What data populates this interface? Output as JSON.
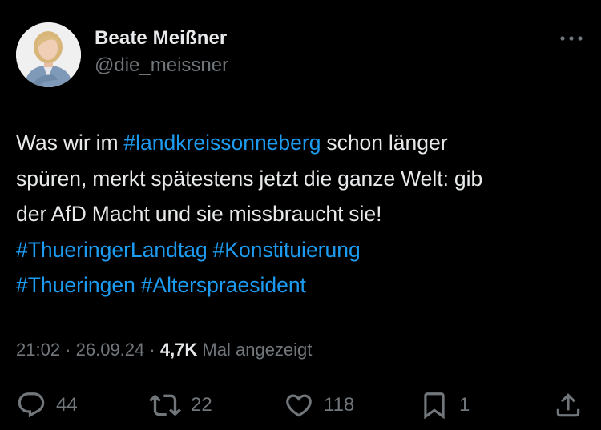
{
  "author": {
    "display_name": "Beate Meißner",
    "handle": "@die_meissner",
    "avatar_icon": "profile-photo"
  },
  "tweet": {
    "lines": [
      [
        {
          "text": "Was wir im ",
          "hashtag": false
        },
        {
          "text": "#landkreissonneberg",
          "hashtag": true
        },
        {
          "text": " schon länger",
          "hashtag": false
        }
      ],
      [
        {
          "text": "spüren, merkt spätestens jetzt die ganze Welt: gib",
          "hashtag": false
        }
      ],
      [
        {
          "text": "der AfD Macht und sie missbraucht sie!",
          "hashtag": false
        }
      ],
      [
        {
          "text": "#ThueringerLandtag",
          "hashtag": true
        },
        {
          "text": " ",
          "hashtag": false
        },
        {
          "text": "#Konstituierung",
          "hashtag": true
        }
      ],
      [
        {
          "text": "#Thueringen",
          "hashtag": true
        },
        {
          "text": " ",
          "hashtag": false
        },
        {
          "text": "#Alterspraesident",
          "hashtag": true
        }
      ]
    ]
  },
  "meta": {
    "time": "21:02",
    "separator": " · ",
    "date": "26.09.24",
    "views_count": "4,7K",
    "views_label": " Mal angezeigt"
  },
  "actions": {
    "replies": {
      "icon": "reply-icon",
      "count": "44"
    },
    "reposts": {
      "icon": "repost-icon",
      "count": "22"
    },
    "likes": {
      "icon": "like-icon",
      "count": "118"
    },
    "bookmarks": {
      "icon": "bookmark-icon",
      "count": "1"
    },
    "share": {
      "icon": "share-icon"
    }
  },
  "colors": {
    "background": "#000000",
    "text_primary": "#e7e9ea",
    "text_secondary": "#71767b",
    "link": "#1d9bf0"
  }
}
